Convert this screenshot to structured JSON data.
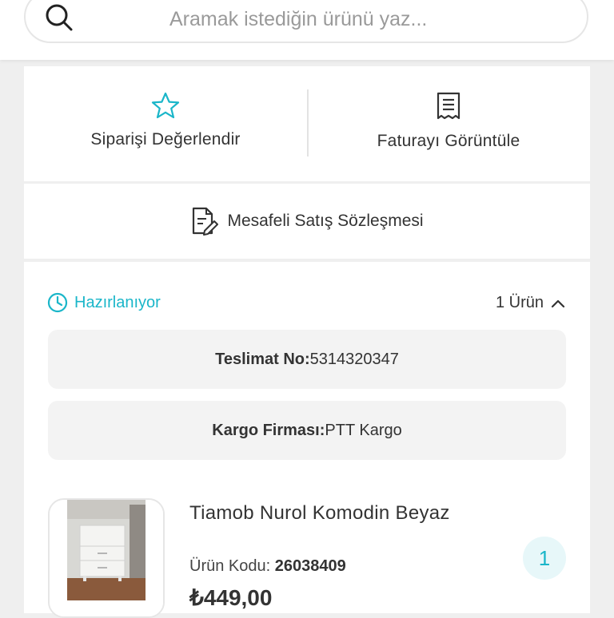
{
  "search": {
    "placeholder": "Aramak istediğin ürünü yaz..."
  },
  "actions": {
    "rate_label": "Siparişi Değerlendir",
    "invoice_label": "Faturayı Görüntüle",
    "contract_label": "Mesafeli Satış Sözleşmesi"
  },
  "order": {
    "status": "Hazırlanıyor",
    "item_count": "1 Ürün",
    "delivery_label": "Teslimat No:",
    "delivery_no": "5314320347",
    "cargo_label": "Kargo Firması:",
    "cargo_company": "PTT Kargo"
  },
  "product": {
    "name": "Tiamob Nurol Komodin Beyaz",
    "code_label": "Ürün Kodu:",
    "code": "26038409",
    "price": "₺449,00",
    "quantity": "1"
  },
  "colors": {
    "accent": "#1ab6c9",
    "background": "#efefef"
  }
}
